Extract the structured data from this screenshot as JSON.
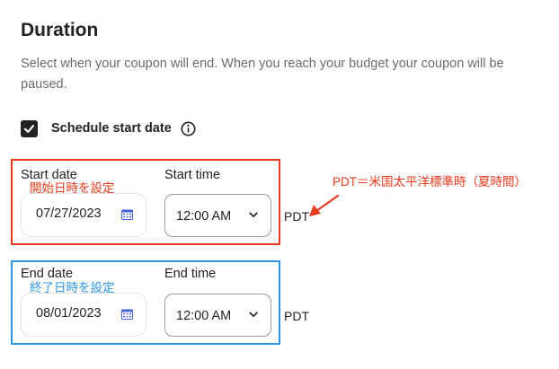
{
  "section": {
    "title": "Duration",
    "description": "Select when your coupon will end. When you reach your budget your coupon will be paused."
  },
  "schedule": {
    "checked": true,
    "label": "Schedule start date",
    "info_icon": "info-circle-icon"
  },
  "start": {
    "date_label": "Start date",
    "date_value": "07/27/2023",
    "time_label": "Start time",
    "time_value": "12:00 AM",
    "timezone": "PDT"
  },
  "end": {
    "date_label": "End date",
    "date_value": "08/01/2023",
    "time_label": "End time",
    "time_value": "12:00 AM",
    "timezone": "PDT"
  },
  "annotations": {
    "start_note": "開始日時を設定",
    "end_note": "終了日時を設定",
    "pdt_note": "PDT＝米国太平洋標準時（夏時間）"
  },
  "colors": {
    "annotation_red": "#e8391d",
    "annotation_blue": "#2f95e2",
    "calendar_icon": "#3d63d6"
  },
  "icons": {
    "calendar": "calendar-icon",
    "chevron": "chevron-down-icon",
    "check": "check-icon"
  }
}
